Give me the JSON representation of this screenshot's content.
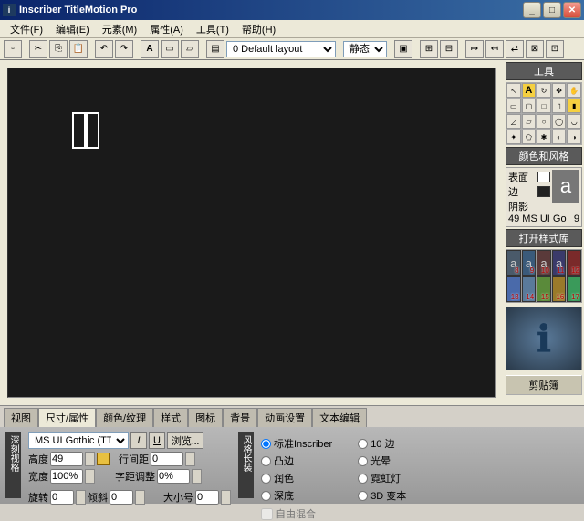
{
  "title": "Inscriber TitleMotion Pro",
  "menu": [
    "文件(F)",
    "编辑(E)",
    "元素(M)",
    "属性(A)",
    "工具(T)",
    "帮助(H)"
  ],
  "toolbar": {
    "layout_sel": "0 Default layout",
    "static_sel": "静态"
  },
  "rpanel": {
    "tools_hdr": "工具",
    "colors_hdr": "颜色和风格",
    "surface": "表面",
    "edge": "边",
    "shadow": "阴影",
    "font_info_l": "49 MS UI Go",
    "font_info_r": "9",
    "stylelib_hdr": "打开样式库",
    "style_nums": [
      "8",
      "9",
      "10",
      "11",
      "12",
      "13",
      "14",
      "15",
      "16",
      "17"
    ],
    "clipboard": "剪贴簿"
  },
  "tabs": [
    "视图",
    "尺寸/属性",
    "颜色/纹理",
    "样式",
    "图标",
    "背景",
    "动画设置",
    "文本编辑"
  ],
  "panel": {
    "vtab1": "深刻视格",
    "vtab2": "风格长装",
    "font_sel": "MS UI Gothic (TT)",
    "browse": "浏览...",
    "height_l": "高度",
    "height_v": "49",
    "width_l": "宽度",
    "width_v": "100%",
    "linesp_l": "行间距",
    "linesp_v": "0",
    "kern_l": "字距调整",
    "kern_v": "0%",
    "rotate_l": "旋转",
    "rotate_v": "0",
    "skew_l": "倾斜",
    "skew_v": "0",
    "size_l": "大小号",
    "size_v": "0",
    "radios": [
      "标准Inscriber",
      "10 边",
      "凸边",
      "光晕",
      "润色",
      "霓虹灯",
      "深底",
      "3D 变本"
    ],
    "freemix": "自由混合"
  }
}
